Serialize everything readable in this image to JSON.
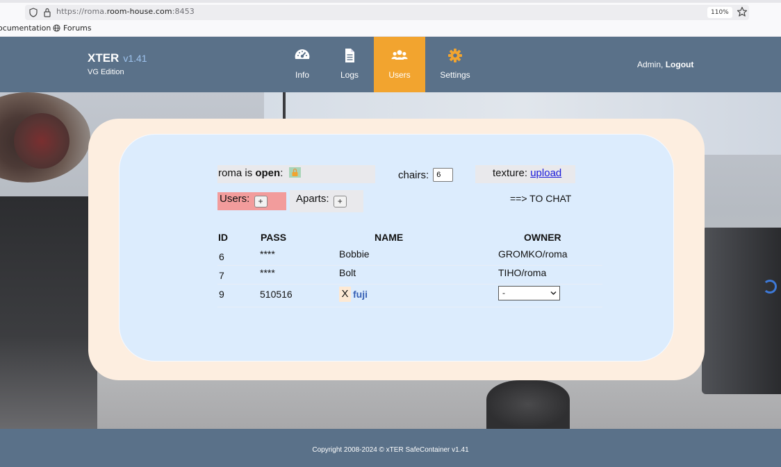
{
  "browser": {
    "url_prefix": "https://roma.",
    "url_domain": "room-house.com",
    "url_port": ":8453",
    "zoom": "110%",
    "bookmarks": [
      "ocumentation",
      "Forums"
    ]
  },
  "header": {
    "brand": "XTER",
    "version": "v1.41",
    "edition": "VG Edition",
    "nav": [
      {
        "label": "Info",
        "icon": "dashboard-gauge-icon"
      },
      {
        "label": "Logs",
        "icon": "document-icon"
      },
      {
        "label": "Users",
        "icon": "users-icon",
        "active": true
      },
      {
        "label": "Settings",
        "icon": "gear-icon"
      }
    ],
    "user_name": "Admin,",
    "logout_label": "Logout"
  },
  "room": {
    "name": "roma",
    "is_label": " is ",
    "state": "open",
    "colon": ":",
    "chairs_label": "chairs:",
    "chairs_value": "6",
    "texture_label": "texture: ",
    "texture_link": "upload",
    "users_label": "Users:",
    "aparts_label": "Aparts:",
    "plus": "+",
    "to_chat": "==> TO CHAT"
  },
  "table": {
    "headers": {
      "id": "ID",
      "pass": "PASS",
      "name": "NAME",
      "owner": "OWNER"
    },
    "rows": [
      {
        "id": "6",
        "pass": "****",
        "name": "Bobbie",
        "owner": "GROMKO/roma"
      },
      {
        "id": "7",
        "pass": "****",
        "name": "Bolt",
        "owner": "TIHO/roma"
      },
      {
        "id": "9",
        "pass": "510516",
        "delete": "X",
        "name": "fuji",
        "owner_select": "-"
      }
    ]
  },
  "footer": {
    "copyright": "Copyright 2008-2024 © xTER SafeContainer v1.41"
  },
  "colors": {
    "header_bg": "#5a7189",
    "active_nav": "#f2a42f",
    "outer_card": "#fdeee0",
    "inner_card": "#dcecfd",
    "users_box": "#f29c9c",
    "link": "#1a1adb",
    "name_link": "#3861b5"
  }
}
